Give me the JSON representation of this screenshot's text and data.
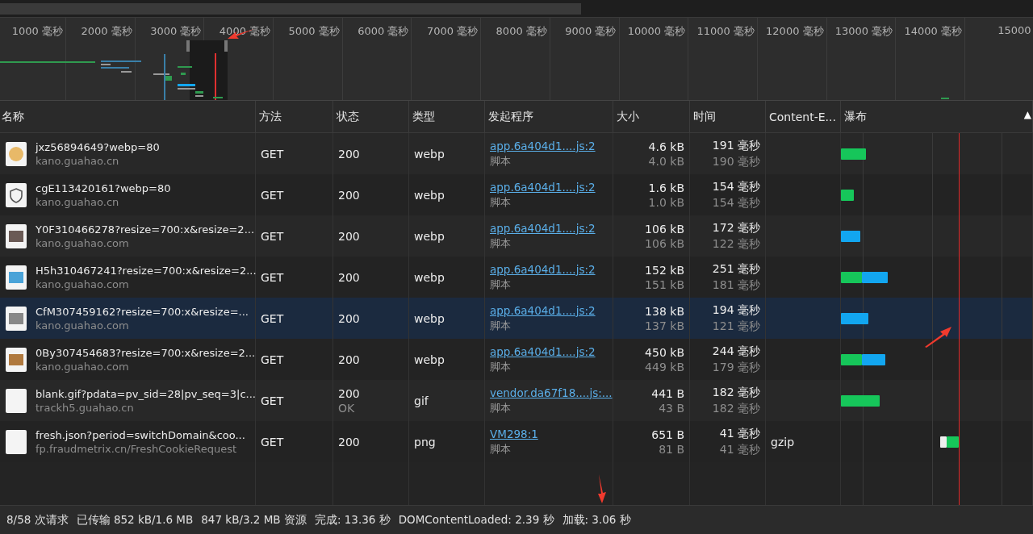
{
  "overview": {
    "ticks": [
      "1000 毫秒",
      "2000 毫秒",
      "3000 毫秒",
      "4000 毫秒",
      "5000 毫秒",
      "6000 毫秒",
      "7000 毫秒",
      "8000 毫秒",
      "9000 毫秒",
      "10000 毫秒",
      "11000 毫秒",
      "12000 毫秒",
      "13000 毫秒",
      "14000 毫秒",
      "15000"
    ]
  },
  "table": {
    "columns": [
      "名称",
      "方法",
      "状态",
      "类型",
      "发起程序",
      "大小",
      "时间",
      "Content-E...",
      "瀑布"
    ],
    "sort_indicator": "▲",
    "rows": [
      {
        "name": "jxz56894649?webp=80",
        "domain": "kano.guahao.cn",
        "method": "GET",
        "status": "200",
        "type": "webp",
        "initiator": "app.6a404d1....js:2",
        "initiator_type": "脚本",
        "size": "4.6 kB",
        "resource_size": "4.0 kB",
        "time": "191 毫秒",
        "latency": "190 毫秒",
        "selected": false
      },
      {
        "name": "cgE113420161?webp=80",
        "domain": "kano.guahao.cn",
        "method": "GET",
        "status": "200",
        "type": "webp",
        "initiator": "app.6a404d1....js:2",
        "initiator_type": "脚本",
        "size": "1.6 kB",
        "resource_size": "1.0 kB",
        "time": "154 毫秒",
        "latency": "154 毫秒",
        "selected": false
      },
      {
        "name": "Y0F310466278?resize=700:x&resize=2...",
        "domain": "kano.guahao.com",
        "method": "GET",
        "status": "200",
        "type": "webp",
        "initiator": "app.6a404d1....js:2",
        "initiator_type": "脚本",
        "size": "106 kB",
        "resource_size": "106 kB",
        "time": "172 毫秒",
        "latency": "122 毫秒",
        "selected": false
      },
      {
        "name": "H5h310467241?resize=700:x&resize=2...",
        "domain": "kano.guahao.com",
        "method": "GET",
        "status": "200",
        "type": "webp",
        "initiator": "app.6a404d1....js:2",
        "initiator_type": "脚本",
        "size": "152 kB",
        "resource_size": "151 kB",
        "time": "251 毫秒",
        "latency": "181 毫秒",
        "selected": false
      },
      {
        "name": "CfM307459162?resize=700:x&resize=...",
        "domain": "kano.guahao.com",
        "method": "GET",
        "status": "200",
        "type": "webp",
        "initiator": "app.6a404d1....js:2",
        "initiator_type": "脚本",
        "size": "138 kB",
        "resource_size": "137 kB",
        "time": "194 毫秒",
        "latency": "121 毫秒",
        "selected": true
      },
      {
        "name": "0By307454683?resize=700:x&resize=2...",
        "domain": "kano.guahao.com",
        "method": "GET",
        "status": "200",
        "type": "webp",
        "initiator": "app.6a404d1....js:2",
        "initiator_type": "脚本",
        "size": "450 kB",
        "resource_size": "449 kB",
        "time": "244 毫秒",
        "latency": "179 毫秒",
        "selected": false
      },
      {
        "name": "blank.gif?pdata=pv_sid=28|pv_seq=3|c...",
        "domain": "trackh5.guahao.cn",
        "method": "GET",
        "status": "200",
        "status_text": "OK",
        "type": "gif",
        "initiator": "vendor.da67f18....js:...",
        "initiator_type": "脚本",
        "size": "441 B",
        "resource_size": "43 B",
        "time": "182 毫秒",
        "latency": "182 毫秒",
        "selected": false
      },
      {
        "name": "fresh.json?period=switchDomain&coo...",
        "domain": "fp.fraudmetrix.cn/FreshCookieRequest",
        "method": "GET",
        "status": "200",
        "type": "png",
        "initiator": "VM298:1",
        "initiator_type": "脚本",
        "size": "651 B",
        "resource_size": "81 B",
        "time": "41 毫秒",
        "latency": "41 毫秒",
        "content_encoding": "gzip",
        "selected": false
      }
    ]
  },
  "status_bar": [
    "8/58 次请求",
    "已传输 852 kB/1.6 MB",
    "847 kB/3.2 MB 资源",
    "完成: 13.36 秒",
    "DOMContentLoaded: 2.39 秒",
    "加载: 3.06 秒"
  ]
}
